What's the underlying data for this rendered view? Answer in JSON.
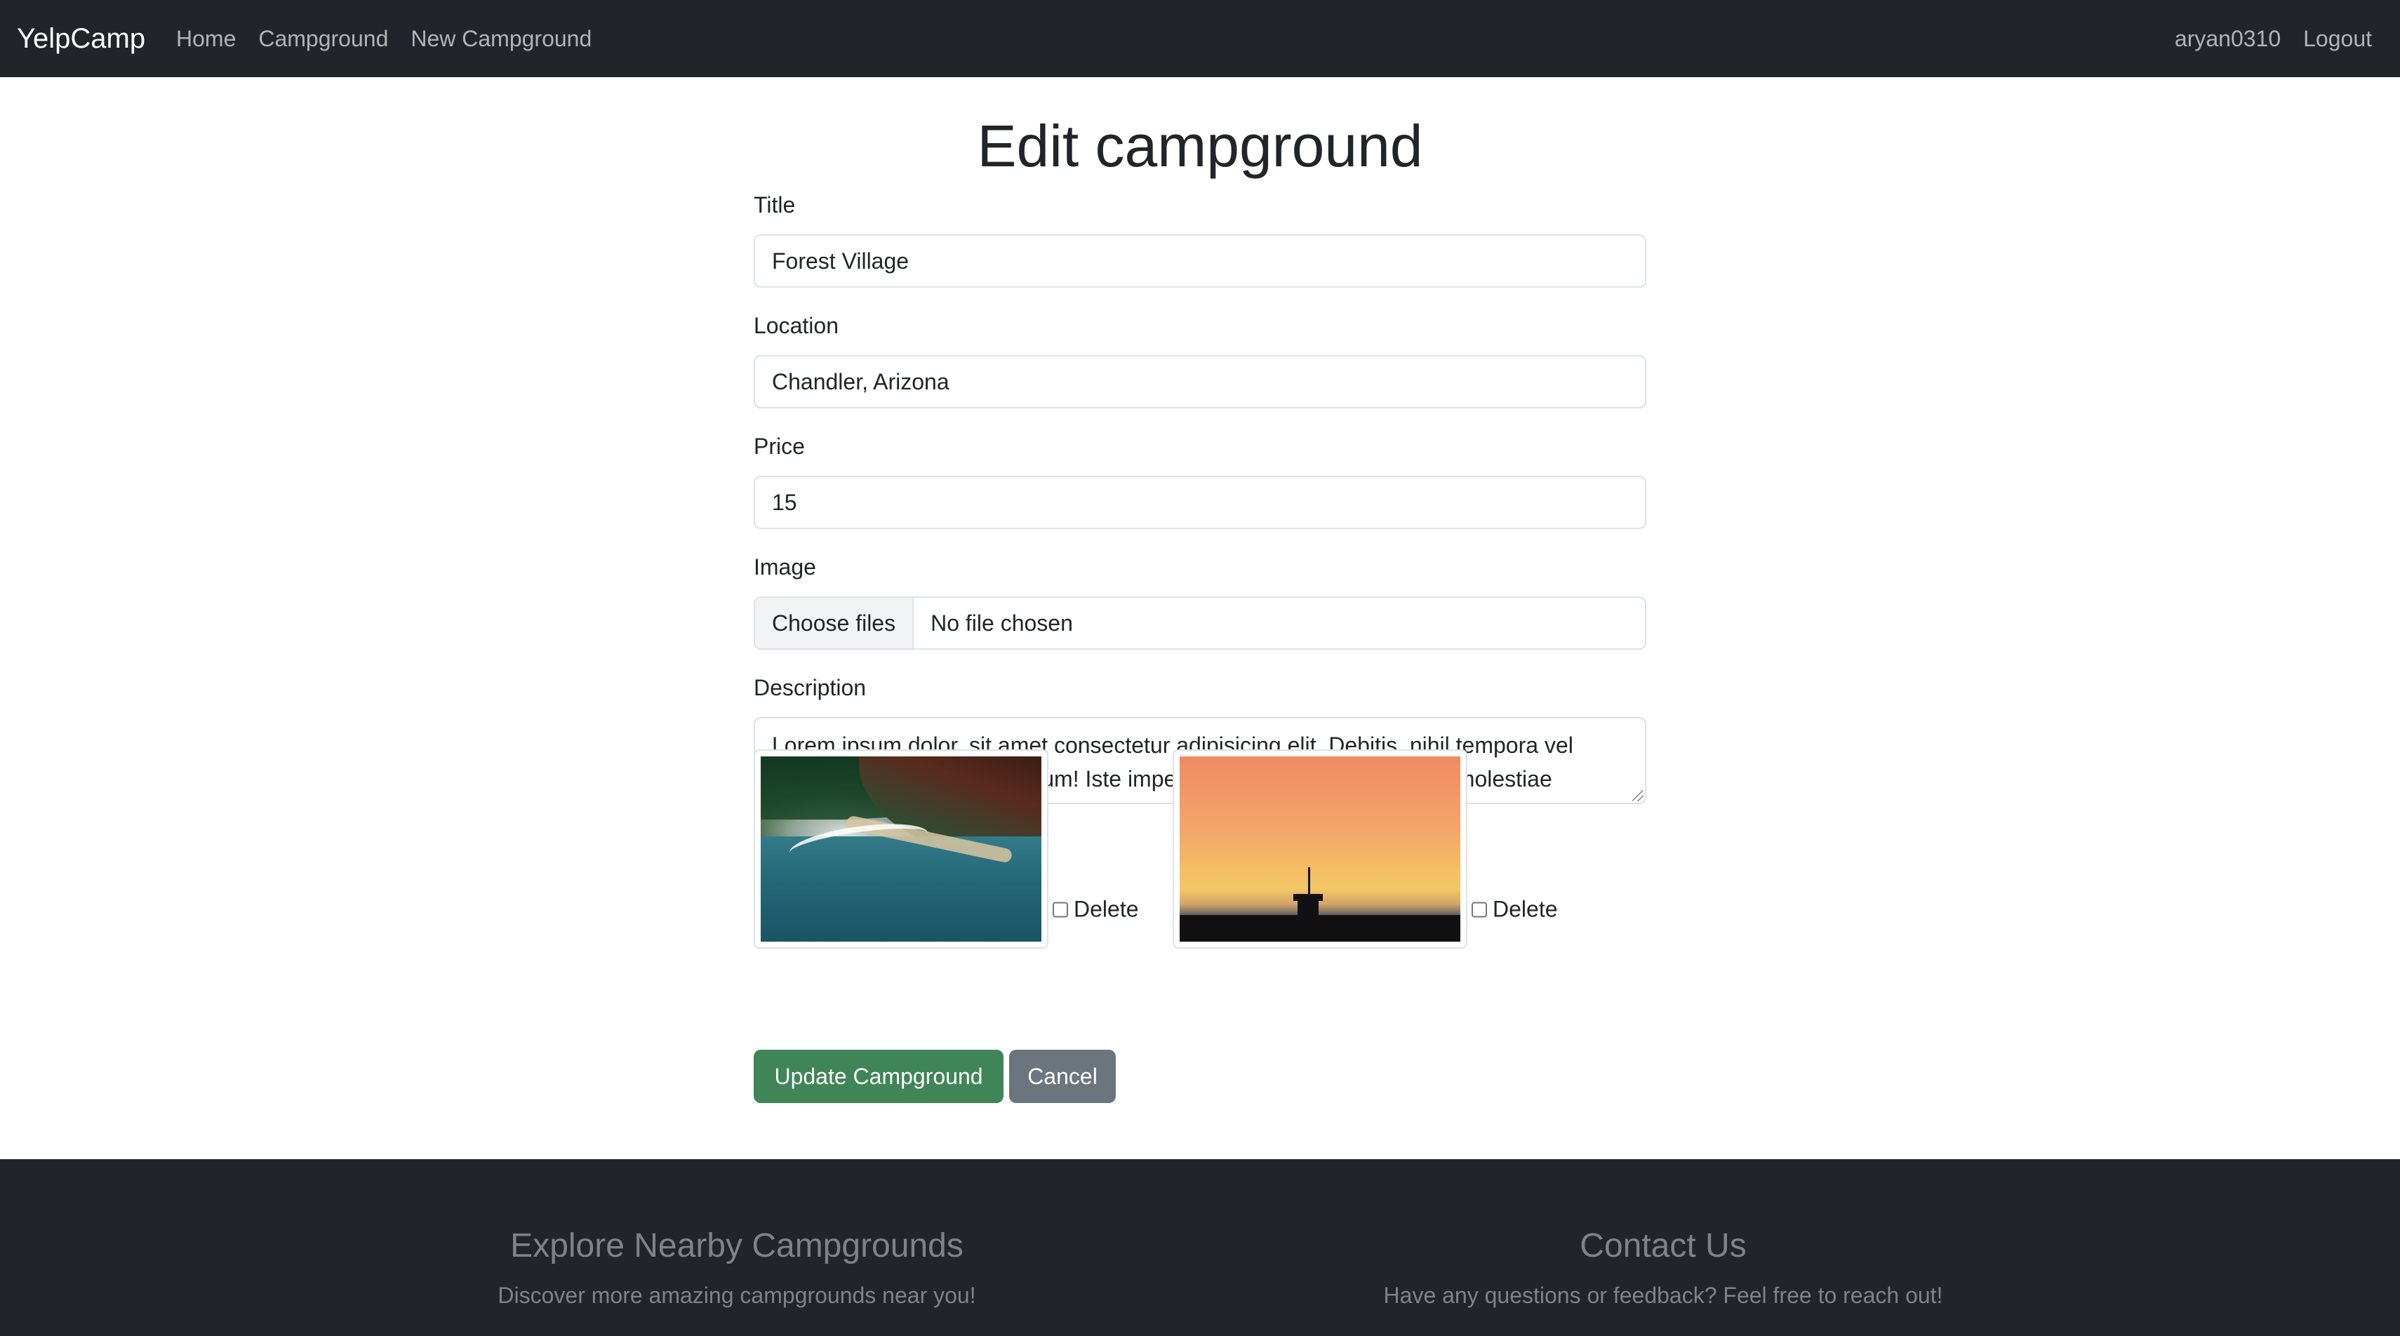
{
  "navbar": {
    "brand": "YelpCamp",
    "links": [
      "Home",
      "Campground",
      "New Campground"
    ],
    "username": "aryan0310",
    "logout": "Logout"
  },
  "page": {
    "title": "Edit campground"
  },
  "form": {
    "title_label": "Title",
    "title_value": "Forest Village",
    "location_label": "Location",
    "location_value": "Chandler, Arizona",
    "price_label": "Price",
    "price_value": "15",
    "image_label": "Image",
    "file_button": "Choose files",
    "file_status": "No file chosen",
    "description_label": "Description",
    "description_value": "Lorem ipsum dolor, sit amet consectetur adipisicing elit. Debitis, nihil tempora vel aspernatur quod aliquam illum! Iste impedit odio esse neque veniam molestiae"
  },
  "images": [
    {
      "delete_label": "Delete",
      "checked": false
    },
    {
      "delete_label": "Delete",
      "checked": false
    }
  ],
  "buttons": {
    "update": "Update Campground",
    "cancel": "Cancel"
  },
  "footer": {
    "explore_heading": "Explore Nearby Campgrounds",
    "explore_text": "Discover more amazing campgrounds near you!",
    "contact_heading": "Contact Us",
    "contact_text": "Have any questions or feedback? Feel free to reach out!"
  },
  "colors": {
    "navbar_bg": "#212529",
    "success": "#3f8557",
    "secondary": "#6c757d",
    "footer_bg": "#212529"
  }
}
